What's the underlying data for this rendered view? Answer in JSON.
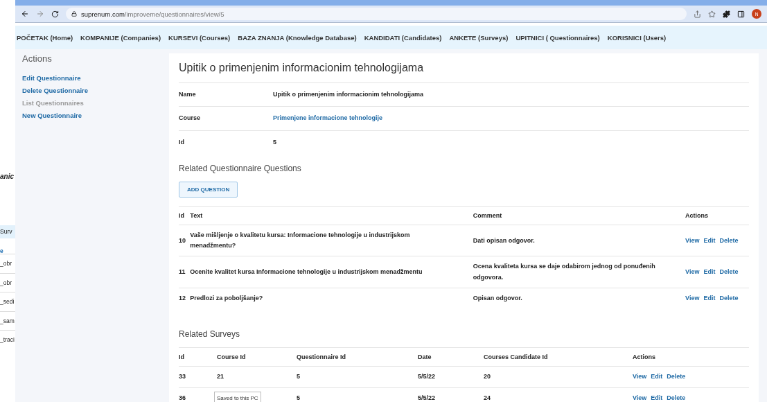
{
  "background_window": {
    "fragments": [
      {
        "kind": "title",
        "text": "anic"
      },
      {
        "kind": "band",
        "text": "Surv"
      },
      {
        "kind": "link",
        "text": "e"
      },
      {
        "kind": "row",
        "text": "_obr"
      },
      {
        "kind": "row",
        "text": "_obr"
      },
      {
        "kind": "row",
        "text": "_sedi"
      },
      {
        "kind": "row",
        "text": "_sam"
      },
      {
        "kind": "row",
        "text": "_traci"
      }
    ]
  },
  "browser": {
    "url_host": "suprenum.com",
    "url_path": "/improveme/questionnaires/view/5",
    "profile_initial": "N"
  },
  "nav": [
    "POČETAK (Home)",
    "KOMPANIJE (Companies)",
    "KURSEVI (Courses)",
    "BAZA ZNANJA (Knowledge Database)",
    "KANDIDATI (Candidates)",
    "ANKETE (Surveys)",
    "UPITNICI ( Questionnaires)",
    "KORISNICI (Users)"
  ],
  "sidebar": {
    "title": "Actions",
    "items": [
      {
        "label": "Edit Questionnaire",
        "disabled": false
      },
      {
        "label": "Delete Questionnaire",
        "disabled": false
      },
      {
        "label": "List Questionnaires",
        "disabled": true
      },
      {
        "label": "New Questionnaire",
        "disabled": false
      }
    ]
  },
  "main": {
    "title": "Upitik o primenjenim informacionim tehnologijama",
    "fields": [
      {
        "label": "Name",
        "value": "Upitik o primenjenim informacionim tehnologijama",
        "kind": "text"
      },
      {
        "label": "Course",
        "value": "Primenjene informacione tehnologije",
        "kind": "link"
      },
      {
        "label": "Id",
        "value": "5",
        "kind": "text"
      }
    ],
    "questions": {
      "title": "Related Questionnaire Questions",
      "add_button": "ADD QUESTION",
      "columns": [
        "Id",
        "Text",
        "Comment",
        "Actions"
      ],
      "rows": [
        {
          "id": "10",
          "text": "Vaše mišljenje o kvalitetu kursa: Informacione tehnologije u industrijskom menadžmentu?",
          "comment": "Dati opisan odgovor.",
          "actions": [
            "View",
            "Edit",
            "Delete"
          ]
        },
        {
          "id": "11",
          "text": "Ocenite kvalitet kursa Informacione tehnologije u industrijskom menadžmentu",
          "comment": "Ocena kvaliteta kursa se daje odabirom jednog od ponuđenih odgovora.",
          "actions": [
            "View",
            "Edit",
            "Delete"
          ]
        },
        {
          "id": "12",
          "text": "Predlozi za poboljšanje?",
          "comment": "Opisan odgovor.",
          "actions": [
            "View",
            "Edit",
            "Delete"
          ]
        }
      ]
    },
    "surveys": {
      "title": "Related Surveys",
      "columns": [
        "Id",
        "Course Id",
        "Questionnaire Id",
        "Date",
        "Courses Candidate Id",
        "Actions"
      ],
      "rows": [
        {
          "cells": [
            "33",
            "21",
            "5",
            "5/5/22",
            "20"
          ],
          "actions": [
            "View",
            "Edit",
            "Delete"
          ]
        },
        {
          "cells": [
            "36",
            "",
            "5",
            "5/5/22",
            "24"
          ],
          "actions": [
            "View",
            "Edit",
            "Delete"
          ]
        }
      ]
    }
  },
  "tooltip": {
    "text": "Saved to this PC"
  }
}
